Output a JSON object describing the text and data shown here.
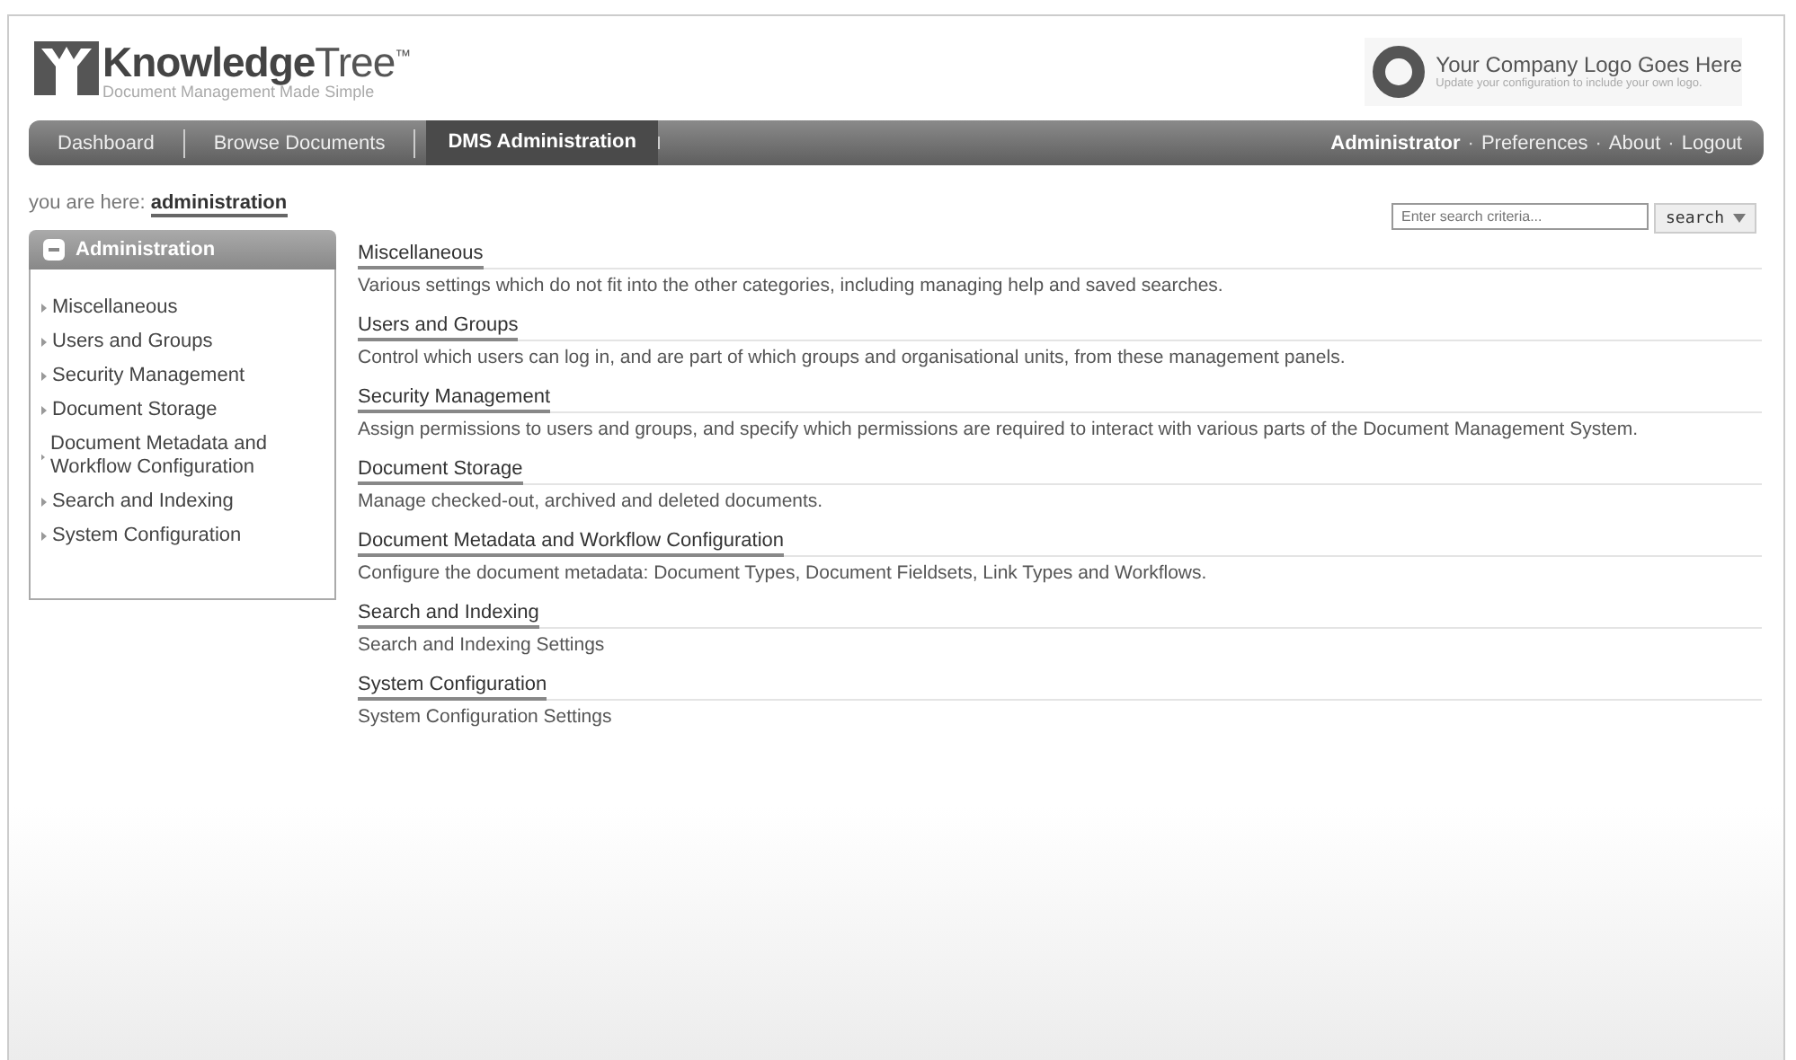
{
  "header": {
    "logo_title": "**Knowledge**Tree$^{™}$",
    "logo_tagline": "Document Management Made Simple",
    "company_logo": {
      "title": "Your Company Logo Goes Here",
      "subtitle": "Update your configuration to include your own logo."
    }
  },
  "nav": {
    "tabs": [
      {
        "label": "Dashboard",
        "selected": false
      },
      {
        "label": "Browse Documents",
        "selected": false
      },
      {
        "label": "DMS Administration",
        "selected": true
      }
    ],
    "user_menu": {
      "user": "Administrator",
      "separator": "·",
      "links": [
        "Preferences",
        "About",
        "Logout"
      ]
    }
  },
  "breadcrumb": {
    "prefix": "you are here:",
    "current": "administration"
  },
  "search": {
    "placeholder": "Enter search criteria...",
    "button": "search"
  },
  "sidebar": {
    "title": "Administration",
    "expanded": true,
    "items": [
      "Miscellaneous",
      "Users and Groups",
      "Security Management",
      "Document Storage",
      "Document Metadata and Workflow Configuration",
      "Search and Indexing",
      "System Configuration"
    ]
  },
  "sections": [
    {
      "title": "Miscellaneous",
      "description": "Various settings which do not fit into the other categories, including managing help and saved searches."
    },
    {
      "title": "Users and Groups",
      "description": "Control which users can log in, and are part of which groups and organisational units, from these management panels."
    },
    {
      "title": "Security Management",
      "description": "Assign permissions to users and groups, and specify which permissions are required to interact with various parts of the Document Management System."
    },
    {
      "title": "Document Storage",
      "description": "Manage checked-out, archived and deleted documents."
    },
    {
      "title": "Document Metadata and Workflow Configuration",
      "description": "Configure the document metadata: Document Types, Document Fieldsets, Link Types and Workflows."
    },
    {
      "title": "Search and Indexing",
      "description": "Search and Indexing Settings"
    },
    {
      "title": "System Configuration",
      "description": "System Configuration Settings"
    }
  ]
}
